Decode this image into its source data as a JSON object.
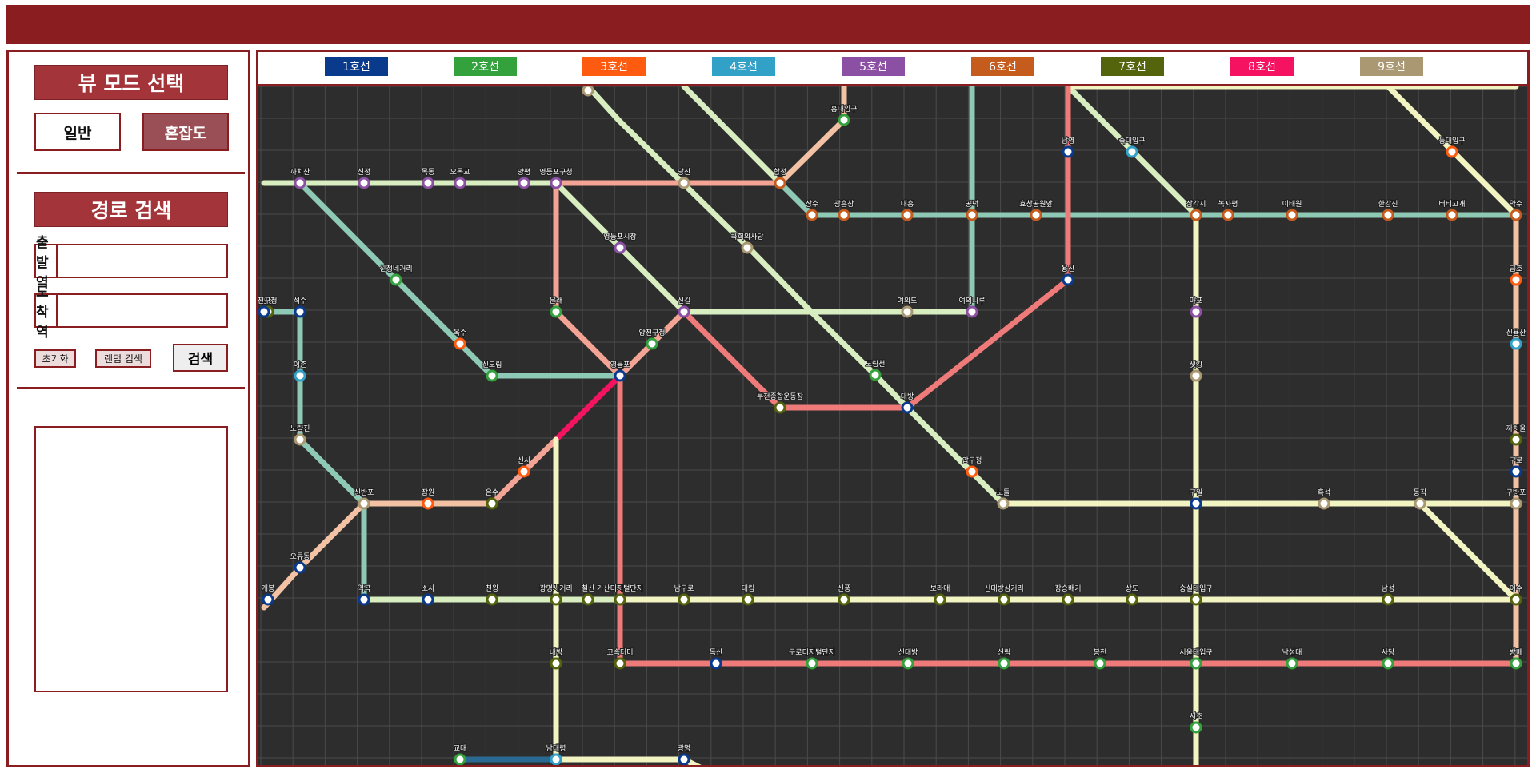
{
  "sidebar": {
    "mode_title": "뷰 모드 선택",
    "mode_normal": "일반",
    "mode_congestion": "혼잡도",
    "route_title": "경로 검색",
    "departure_label": "출발역",
    "arrival_label": "도착역",
    "reset_label": "초기화",
    "random_label": "랜덤 검색",
    "search_label": "검색"
  },
  "legend": [
    {
      "label": "1호선",
      "color": "#0a3a8c"
    },
    {
      "label": "2호선",
      "color": "#33a23d"
    },
    {
      "label": "3호선",
      "color": "#fe5b10"
    },
    {
      "label": "4호선",
      "color": "#32a1c8"
    },
    {
      "label": "5호선",
      "color": "#8b50a4"
    },
    {
      "label": "6호선",
      "color": "#c55c1d"
    },
    {
      "label": "7호선",
      "color": "#54640d"
    },
    {
      "label": "8호선",
      "color": "#f51361"
    },
    {
      "label": "9호선",
      "color": "#aa9872"
    }
  ],
  "map": {
    "background": "#2d2d2d",
    "grid_color": "#4a4a4a",
    "line_colors": {
      "mint": "#8ec9b5",
      "cream": "#f2f5c2",
      "pale_green": "#d8eec0",
      "salmon": "#f3a495",
      "peach": "#f3c2a4",
      "red": "#ef7a7a",
      "pink": "#f51361",
      "navy_path": "#2a6a92"
    },
    "stations": [
      {
        "name": "선유도",
        "line": "9호선"
      },
      {
        "name": "홍대입구",
        "line": "2호선"
      },
      {
        "name": "당산",
        "line": "9호선"
      },
      {
        "name": "합정",
        "line": "6호선"
      },
      {
        "name": "까치산",
        "line": "5호선"
      },
      {
        "name": "신정",
        "line": "5호선"
      },
      {
        "name": "목동",
        "line": "5호선"
      },
      {
        "name": "오목교",
        "line": "5호선"
      },
      {
        "name": "양평",
        "line": "5호선"
      },
      {
        "name": "영등포구청",
        "line": "5호선"
      },
      {
        "name": "상수",
        "line": "6호선"
      },
      {
        "name": "광흥창",
        "line": "6호선"
      },
      {
        "name": "대흥",
        "line": "6호선"
      },
      {
        "name": "공덕",
        "line": "6호선"
      },
      {
        "name": "효창공원앞",
        "line": "6호선"
      },
      {
        "name": "삼각지",
        "line": "6호선"
      },
      {
        "name": "녹사평",
        "line": "6호선"
      },
      {
        "name": "이태원",
        "line": "6호선"
      },
      {
        "name": "한강진",
        "line": "6호선"
      },
      {
        "name": "버티고개",
        "line": "6호선"
      },
      {
        "name": "약수",
        "line": "6호선"
      },
      {
        "name": "남영",
        "line": "1호선"
      },
      {
        "name": "숙대입구",
        "line": "4호선"
      },
      {
        "name": "동대입구",
        "line": "3호선"
      },
      {
        "name": "영등포시장",
        "line": "5호선"
      },
      {
        "name": "국회의사당",
        "line": "9호선"
      },
      {
        "name": "신정네거리",
        "line": "2호선"
      },
      {
        "name": "용산",
        "line": "1호선"
      },
      {
        "name": "금호",
        "line": "3호선"
      },
      {
        "name": "신풍",
        "line": "7호선"
      },
      {
        "name": "문래",
        "line": "2호선"
      },
      {
        "name": "신길",
        "line": "5호선"
      },
      {
        "name": "여의도",
        "line": "9호선"
      },
      {
        "name": "여의나루",
        "line": "5호선"
      },
      {
        "name": "마포",
        "line": "5호선"
      },
      {
        "name": "신용산",
        "line": "4호선"
      },
      {
        "name": "옥수",
        "line": "3호선"
      },
      {
        "name": "양천구청",
        "line": "2호선"
      },
      {
        "name": "영등포",
        "line": "1호선"
      },
      {
        "name": "신도림",
        "line": "2호선"
      },
      {
        "name": "도림천",
        "line": "2호선"
      },
      {
        "name": "샛강",
        "line": "9호선"
      },
      {
        "name": "이촌",
        "line": "4호선"
      },
      {
        "name": "부천종합운동장",
        "line": "7호선"
      },
      {
        "name": "대방",
        "line": "1호선"
      },
      {
        "name": "노량진",
        "line": "9호선"
      },
      {
        "name": "까치울",
        "line": "7호선"
      },
      {
        "name": "구로",
        "line": "1호선"
      },
      {
        "name": "압구정",
        "line": "3호선"
      },
      {
        "name": "신사",
        "line": "3호선"
      },
      {
        "name": "노들",
        "line": "9호선"
      },
      {
        "name": "구일",
        "line": "1호선"
      },
      {
        "name": "흑석",
        "line": "9호선"
      },
      {
        "name": "동작",
        "line": "9호선"
      },
      {
        "name": "구반포",
        "line": "9호선"
      },
      {
        "name": "신반포",
        "line": "9호선"
      },
      {
        "name": "잠원",
        "line": "3호선"
      },
      {
        "name": "온수",
        "line": "7호선"
      },
      {
        "name": "오류동",
        "line": "1호선"
      },
      {
        "name": "개봉",
        "line": "1호선"
      },
      {
        "name": "역곡",
        "line": "1호선"
      },
      {
        "name": "소사",
        "line": "1호선"
      },
      {
        "name": "천왕",
        "line": "7호선"
      },
      {
        "name": "광명사거리",
        "line": "7호선"
      },
      {
        "name": "철산",
        "line": "7호선"
      },
      {
        "name": "가산디지털단지",
        "line": "7호선"
      },
      {
        "name": "남구로",
        "line": "7호선"
      },
      {
        "name": "대림",
        "line": "7호선"
      },
      {
        "name": "신풍",
        "line": "7호선"
      },
      {
        "name": "보라매",
        "line": "7호선"
      },
      {
        "name": "신대방삼거리",
        "line": "7호선"
      },
      {
        "name": "장승배기",
        "line": "7호선"
      },
      {
        "name": "상도",
        "line": "7호선"
      },
      {
        "name": "숭실대입구",
        "line": "7호선"
      },
      {
        "name": "남성",
        "line": "7호선"
      },
      {
        "name": "이수",
        "line": "7호선"
      },
      {
        "name": "내방",
        "line": "7호선"
      },
      {
        "name": "고속터미",
        "line": "7호선"
      },
      {
        "name": "독산",
        "line": "1호선"
      },
      {
        "name": "구로디지털단지",
        "line": "2호선"
      },
      {
        "name": "신대방",
        "line": "2호선"
      },
      {
        "name": "신림",
        "line": "2호선"
      },
      {
        "name": "봉천",
        "line": "2호선"
      },
      {
        "name": "서울대입구",
        "line": "2호선"
      },
      {
        "name": "낙성대",
        "line": "2호선"
      },
      {
        "name": "사당",
        "line": "2호선"
      },
      {
        "name": "방배",
        "line": "2호선"
      },
      {
        "name": "서초",
        "line": "2호선"
      },
      {
        "name": "교대",
        "line": "2호선"
      },
      {
        "name": "남태령",
        "line": "4호선"
      },
      {
        "name": "광명",
        "line": "1호선"
      },
      {
        "name": "금천구청",
        "line": "1호선"
      },
      {
        "name": "석수",
        "line": "1호선"
      },
      {
        "name": "신정동",
        "line": "2호선"
      },
      {
        "name": "송정",
        "line": "2호선"
      }
    ]
  }
}
